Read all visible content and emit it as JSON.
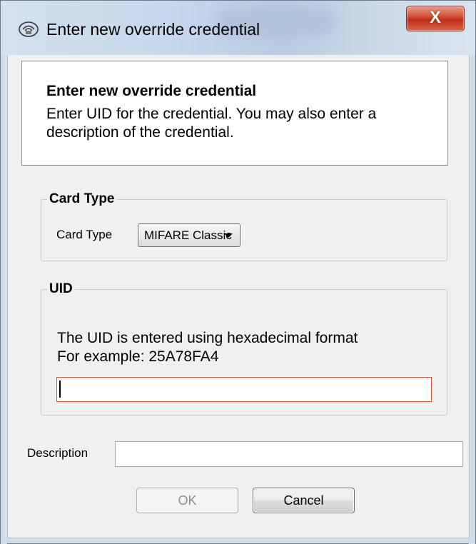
{
  "window": {
    "title": "Enter new override credential",
    "icon": "card-reader-icon",
    "close_label": "X"
  },
  "header": {
    "title": "Enter new override credential",
    "description": "Enter UID for the credential. You may also enter a description of the credential."
  },
  "card_type_group": {
    "legend": "Card Type",
    "label": "Card Type",
    "selected": "MIFARE Classic"
  },
  "uid_group": {
    "legend": "UID",
    "info_line1": "The UID is entered using hexadecimal format",
    "info_line2": "For example: 25A78FA4",
    "value": ""
  },
  "description": {
    "label": "Description",
    "value": ""
  },
  "buttons": {
    "ok": "OK",
    "cancel": "Cancel"
  },
  "colors": {
    "invalid_border": "#e0543b",
    "close_button": "#c8391f"
  }
}
